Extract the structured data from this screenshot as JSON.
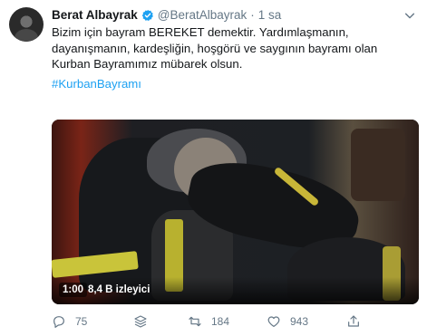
{
  "tweet": {
    "author_name": "Berat Albayrak",
    "handle": "@BeratAlbayrak",
    "separator": "·",
    "time": "1 sa",
    "text": "Bizim için bayram BEREKET demektir. Yardımlaşmanın, dayanışmanın, kardeşliğin, hoşgörü ve saygının bayramı olan Kurban Bayramımız mübarek olsun.",
    "hashtag": "#KurbanBayramı"
  },
  "video": {
    "duration": "1:00",
    "views": "8,4 B izleyici"
  },
  "actions": {
    "reply_count": "75",
    "retweet_count": "184",
    "like_count": "943"
  },
  "colors": {
    "link": "#1da1f2",
    "secondary_text": "#657786",
    "verified": "#1da1f2"
  },
  "icons": [
    "avatar",
    "verified-badge-icon",
    "chevron-down-icon",
    "reply-icon",
    "stack-icon",
    "retweet-icon",
    "like-icon",
    "share-icon"
  ]
}
